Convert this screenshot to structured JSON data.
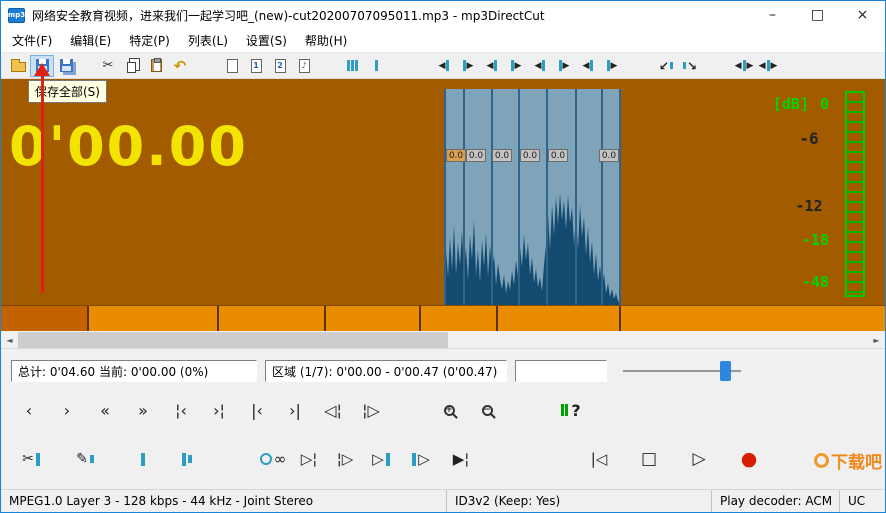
{
  "window": {
    "app_icon": "mp3",
    "title": "网络安全教育视频，进来我们一起学习吧_(new)-cut20200707095011.mp3 - mp3DirectCut",
    "controls": {
      "minimize": "–",
      "maximize": "□",
      "close": "×"
    }
  },
  "menu": [
    "文件(F)",
    "编辑(E)",
    "特定(P)",
    "列表(L)",
    "设置(S)",
    "帮助(H)"
  ],
  "toolbar": {
    "tooltip": "保存全部(S)",
    "cut": "✂",
    "undo": "↶",
    "tag1": "1",
    "tag2": "2",
    "tag3": "♪",
    "arrow_left": "◀",
    "arrow_right": "▶",
    "fade_in": "↙",
    "fade_out": "↘"
  },
  "wave": {
    "time": "0'00.00",
    "db_label": "[dB]",
    "db": [
      "0",
      "-6",
      "-12",
      "-18",
      "-48"
    ],
    "values": [
      "0.0",
      "0.0",
      "0.0",
      "0.0",
      "0.0",
      "0.0"
    ]
  },
  "info": {
    "total": "总计: 0'04.60  当前: 0'00.00  (0%)",
    "region": "区域 (1/7): 0'00.00 - 0'00.47 (0'00.47)"
  },
  "transport1": {
    "buttons": [
      "‹",
      "›",
      "«",
      "»",
      "¦‹",
      "›¦",
      "|‹",
      "›|",
      "◁¦",
      "¦▷"
    ],
    "zoom_in": "+",
    "zoom_out": "−",
    "pause_find": "?"
  },
  "transport2": {
    "scissors": "✂",
    "pencil": "✎",
    "loop": "∞",
    "play_from": "▷¦",
    "play_to": "¦▷",
    "play_bar": "▷",
    "bar_play": "▷",
    "pause_play": "▶¦",
    "skip_start": "|◁",
    "stop": "□",
    "play": "▷",
    "record": "●"
  },
  "icons": {
    "scroll_left": "◄",
    "scroll_right": "►"
  },
  "status": [
    "MPEG1.0 Layer 3 - 128 kbps - 44 kHz - Joint Stereo",
    "ID3v2 (Keep: Yes)",
    "Play decoder: ACM",
    "UC"
  ],
  "watermark": "下载吧",
  "colors": {
    "accent_blue": "#1883D7",
    "wave_bg": "#A35B00",
    "time_yellow": "#F2E300",
    "db_green": "#00CC00",
    "panel_blue": "#7FA3B8",
    "wave_fill": "#134B70",
    "pos_orange": "#EA8C00",
    "pos_orange_dark": "#C26300",
    "teal": "#2E9EC0",
    "record_red": "#D81E00"
  }
}
